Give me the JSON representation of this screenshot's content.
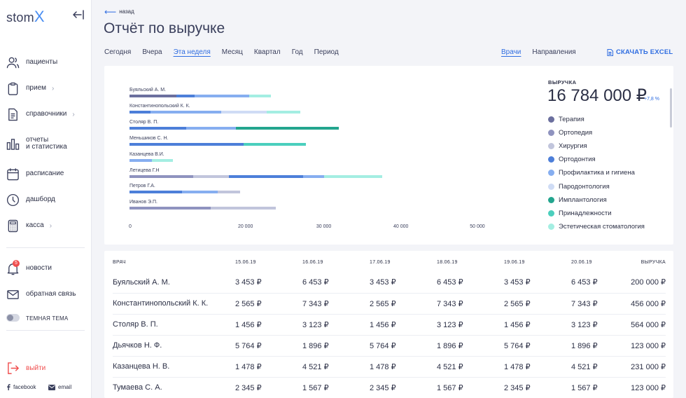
{
  "sidebar": {
    "logo_text": "stom",
    "logo_x": "X",
    "items": [
      {
        "label": "пациенты",
        "icon": "users-icon"
      },
      {
        "label": "прием",
        "icon": "clipboard-icon",
        "chevron": "›"
      },
      {
        "label": "справочники",
        "icon": "document-icon",
        "chevron": "›"
      },
      {
        "label": "отчеты",
        "label2": "и статистика",
        "icon": "bar-chart-icon"
      },
      {
        "label": "расписание",
        "icon": "calendar-icon"
      },
      {
        "label": "дашборд",
        "icon": "clock-icon"
      },
      {
        "label": "касса",
        "icon": "calculator-icon",
        "chevron": "›"
      },
      {
        "label": "новости",
        "icon": "bell-icon",
        "badge": "5"
      },
      {
        "label": "обратная связь",
        "icon": "mail-icon"
      }
    ],
    "theme_toggle_label": "ТЕМНАЯ ТЕМА",
    "logout_label": "выйти",
    "facebook_label": "facebook",
    "email_label": "email"
  },
  "header": {
    "back_label": "назад",
    "title": "Отчёт по выручке",
    "period_tabs": [
      "Сегодня",
      "Вчера",
      "Эта неделя",
      "Месяц",
      "Квартал",
      "Год",
      "Период"
    ],
    "active_period": "Эта неделя",
    "view_tabs": [
      "Врачи",
      "Направления"
    ],
    "active_view": "Врачи",
    "excel_label": "СКАЧАТЬ EXCEL"
  },
  "summary": {
    "title": "ВЫРУЧКА",
    "value": "16 784 000 ₽",
    "delta": "+7,8 %"
  },
  "colors": {
    "Терапия": "#6b6f9e",
    "Ортопедия": "#8f93bf",
    "Хирургия": "#c1c5dc",
    "Ортодонтия": "#4d7fd9",
    "Профилактика и гигиена": "#86aef0",
    "Пародонтология": "#cfdcf5",
    "Имплантология": "#23a58e",
    "Принадлежности": "#4bcfbd",
    "Эстетическая стоматология": "#a4eee2"
  },
  "chart_data": {
    "type": "bar",
    "orientation": "horizontal",
    "stacked": true,
    "xlim": [
      0,
      50000
    ],
    "x_ticks": [
      "0",
      "20 000",
      "30 000",
      "40 000",
      "50 000"
    ],
    "categories": [
      "Буяльский А. М.",
      "Константинопольский К. К.",
      "Столяр В. П.",
      "Меньшиков С. Н.",
      "Казанцева В.И.",
      "Летицева Г.Н",
      "Петров Г.А.",
      "Иванов Э.П."
    ],
    "series": [
      {
        "name": "Терапия",
        "values": [
          6700,
          0,
          0,
          0,
          0,
          0,
          0,
          0
        ]
      },
      {
        "name": "Ортопедия",
        "values": [
          0,
          0,
          0,
          0,
          0,
          9200,
          0,
          11700
        ]
      },
      {
        "name": "Хирургия",
        "values": [
          0,
          0,
          0,
          0,
          0,
          5100,
          0,
          9300
        ]
      },
      {
        "name": "Ортодонтия",
        "values": [
          2700,
          3000,
          8100,
          16400,
          0,
          10700,
          7500,
          0
        ]
      },
      {
        "name": "Профилактика и гигиена",
        "values": [
          7800,
          10200,
          7200,
          0,
          3200,
          3000,
          5200,
          0
        ]
      },
      {
        "name": "Пародонтология",
        "values": [
          0,
          6500,
          0,
          0,
          0,
          0,
          0,
          0
        ]
      },
      {
        "name": "Имплантология",
        "values": [
          0,
          0,
          14800,
          0,
          0,
          0,
          0,
          0
        ]
      },
      {
        "name": "Принадлежности",
        "values": [
          0,
          0,
          0,
          9000,
          0,
          0,
          0,
          0
        ]
      },
      {
        "name": "Эстетическая стоматология",
        "values": [
          3100,
          4800,
          0,
          0,
          3000,
          8300,
          0,
          0
        ]
      }
    ],
    "extra_segments": [
      {
        "row": 6,
        "name": "Хирургия",
        "value": 3200
      }
    ],
    "legend": [
      "Терапия",
      "Ортопедия",
      "Хирургия",
      "Ортодонтия",
      "Профилактика и гигиена",
      "Пародонтология",
      "Имплантология",
      "Принадлежности",
      "Эстетическая стоматология"
    ],
    "legend_position": "right"
  },
  "table": {
    "headers": [
      "ВРАЧ",
      "15.06.19",
      "16.06.19",
      "17.06.19",
      "18.06.19",
      "19.06.19",
      "20.06.19",
      "ВЫРУЧКА"
    ],
    "rows": [
      [
        "Буяльский А. М.",
        "3 453 ₽",
        "6 453 ₽",
        "3 453 ₽",
        "6 453 ₽",
        "3 453 ₽",
        "6 453 ₽",
        "200 000 ₽"
      ],
      [
        "Константинопольский К. К.",
        "2 565 ₽",
        "7 343 ₽",
        "2 565 ₽",
        "7 343 ₽",
        "2 565 ₽",
        "7 343 ₽",
        "456 000 ₽"
      ],
      [
        "Столяр В. П.",
        "1 456 ₽",
        "3 123 ₽",
        "1 456 ₽",
        "3 123 ₽",
        "1 456 ₽",
        "3 123 ₽",
        "564 000 ₽"
      ],
      [
        "Дьячков Н. Ф.",
        "5 764 ₽",
        "1 896 ₽",
        "5 764 ₽",
        "1 896 ₽",
        "5 764 ₽",
        "1 896 ₽",
        "123 000 ₽"
      ],
      [
        "Казанцева Н. В.",
        "1 478 ₽",
        "4 521 ₽",
        "1 478 ₽",
        "4 521 ₽",
        "1 478 ₽",
        "4 521 ₽",
        "231 000 ₽"
      ],
      [
        "Тумаева С. А.",
        "2 345 ₽",
        "1 567 ₽",
        "2 345 ₽",
        "1 567 ₽",
        "2 345 ₽",
        "1 567 ₽",
        "123 000 ₽"
      ]
    ]
  }
}
